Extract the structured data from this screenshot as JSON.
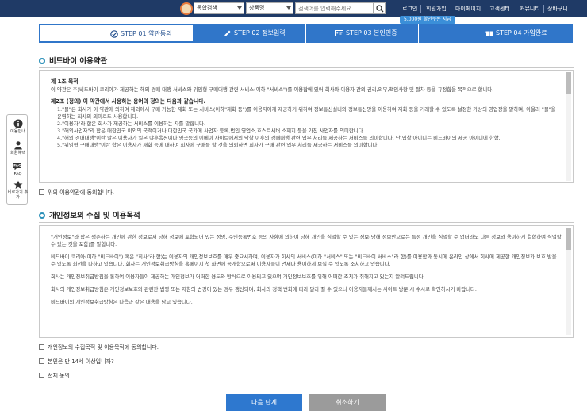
{
  "header": {
    "category_select": "통합검색",
    "type_select": "상품명",
    "search_placeholder": "검색어를 입력해주세요.",
    "nav": [
      "로그인",
      "회원가입",
      "마이페이지",
      "고객센터",
      "커뮤니티",
      "장바구니"
    ],
    "badge": "5,000원 할인쿠폰 지급"
  },
  "steps": [
    {
      "label": "STEP 01 약관동의",
      "icon": "check-circle-icon",
      "active": true
    },
    {
      "label": "STEP 02 정보입력",
      "icon": "pencil-icon",
      "active": false
    },
    {
      "label": "STEP 03 본인인증",
      "icon": "id-card-icon",
      "active": false
    },
    {
      "label": "STEP 04 가입완료",
      "icon": "gift-icon",
      "active": false
    }
  ],
  "sidebar": [
    {
      "label": "이용안내",
      "icon": "info-icon"
    },
    {
      "label": "회원혜택",
      "icon": "user-icon"
    },
    {
      "label": "FAQ",
      "icon": "faq-icon"
    },
    {
      "label": "비로가기 추가",
      "icon": "star-icon"
    }
  ],
  "terms": {
    "title": "비드바이 이용약관",
    "article1_title": "제 1조 목적",
    "article1_body": "이 약관은 주)비드바이 코리아가 제공하는 해외 경매 대행 서비스와 위임형 구매대행 관련 서비스(이하 \"서비스\")를 이용함에 있어 회사와 이용자 간의 권리,의무,책임사항 및 절차 등을 규정함을 목적으로 합니다.",
    "article2_title": "제2조 (정의) 이 약관에서 사용하는 용어의 정의는 다음과 같습니다.",
    "article2_items": [
      "1.\"몰\"은 회사가 이 약관에 의하여 해외에서 구매 가능한 재화 또는 서비스(이하\"재화 등\")를 이용자에게 제공하기 위하여 정보통신설비와 정보통신망을 이용하여 재화 등을 거래할 수 있도록 설정한 가상의 영업장을 말하며, 아울러 \"몰\"을 운영하는 회사의 의미로도 사용합니다.",
      "2.\"이용자\"라 함은 회사가 제공하는 서비스를 이용하는 자를 말합니다.",
      "3.\"해외사업자\"라 함은 대한민국 이외의 국적이거나 대한민국 국가에 사업자 등록,법인,영업소,호스트서버 소재지 등을 가진 사업자를 의미합니다.",
      "4.\"해외 경매대행\"이란 말은 이용자가 일본 야후옥션이나 영국등의 이베이 사이트에서의 낙찰 이후의 경매대행 관련 업무 처리를 제공하는 서비스를 의미합니다. 단,입찰 아이디는 비드바이의 제공 아이디에 한함.",
      "5.\"위임형 구매대행\"이란 함은 이용자가 재화 등에 대하여 회사에 구매를 할 것을 의뢰하면 회사가 구매 관련 업무 처리를 제공하는 서비스를 의미합니다."
    ],
    "agree_label": "위의 이용약관에 동의합니다."
  },
  "privacy": {
    "title": "개인정보의 수집 및 이용목적",
    "paragraphs": [
      "\"개인정보\"라 함은 생존하는 개인에 관한 정보로서 당해 정보에 포함되어 있는 성명, 주민등록번호 등의 사항에 의하여 당해 개인을 식별할 수 있는 정보(당해 정보만으로는 특정 개인을 식별할 수 없더라도 다른 정보와 용이하게 결합하여 식별할 수 있는 것을 포함)를 말합니다.",
      "비드바이 코리아(이하 \"비드바이\") 혹은 \"회사\"라 함)는 이용자의 개인정보보호를 매우 중요시하며, 이용자가 회사의 서비스(이하 \"서비스\" 또는 \"비드바이 서비스\"라 함)를 이용함과 동시에 온라인 상에서 회사에 제공한 개인정보가 보호 받을 수 있도록 최선을 다하고 있습니다. 회사는 개인정보취급방침을 홈페이지 첫 화면에 공개함으로써 이용자들이 언제나 용이하게 보실 수 있도록 조치하고 있습니다.",
      "회사는 개인정보취급방침을 통하여 이용자들이 제공하는 개인정보가 어떠한 용도와 방식으로 이용되고 있으며 개인정보보호를 위해 어떠한 조치가 취해지고 있는지 알려드립니다.",
      "회사의 개인정보취급방침은 개인정보보호와 관련한 법령 또는 지침의 변경이 있는 경우 갱신되며, 회사의 정책 변화에 따라 달라 질 수 있으니 이용자들께서는 사이트 방문 시 수시로 확인하시기 바랍니다.",
      "비드바이의 개인정보취급방침은 다음과 같은 내용을 담고 있습니다."
    ],
    "agree_label": "개인정보의 수집목적 및 이용목적에 동의합니다."
  },
  "age_label": "본인은 만 14세 이상입니까?",
  "all_agree_label": "전체 동의",
  "buttons": {
    "next": "다음 단계",
    "cancel": "취소하기"
  }
}
